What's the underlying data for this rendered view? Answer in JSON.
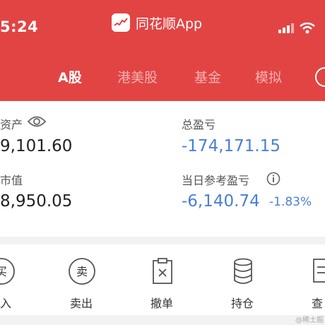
{
  "status_bar": {
    "time": "5:24",
    "app_name": "同花顺App"
  },
  "tabs": [
    {
      "label": "A股",
      "active": true
    },
    {
      "label": "港美股",
      "active": false
    },
    {
      "label": "基金",
      "active": false
    },
    {
      "label": "模拟",
      "active": false
    }
  ],
  "summary": {
    "assets_label": "资产",
    "assets_value": "9,101.60",
    "market_value_label": "市值",
    "market_value": "8,950.05",
    "total_pl_label": "总盈亏",
    "total_pl_value": "-174,171.15",
    "daily_pl_label": "当日参考盈亏",
    "daily_pl_value": "-6,140.74",
    "daily_pl_percent": "-1.83%"
  },
  "actions": [
    {
      "label": "入",
      "icon_text": "买",
      "icon": "buy-icon"
    },
    {
      "label": "卖出",
      "icon_text": "卖",
      "icon": "sell-icon"
    },
    {
      "label": "撤单",
      "icon": "cancel-order-icon"
    },
    {
      "label": "持仓",
      "icon": "holdings-icon"
    },
    {
      "label": "查",
      "icon": "query-icon"
    }
  ],
  "watermark": "@稀土掘",
  "colors": {
    "header": "#e24444",
    "negative": "#4a7fd6",
    "tab_inactive": "#f4b0b0"
  }
}
